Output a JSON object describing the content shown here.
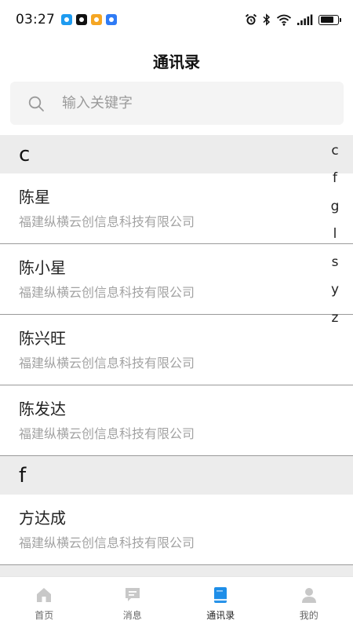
{
  "status_bar": {
    "time": "03:27",
    "app_icons": [
      {
        "name": "message-app-icon",
        "color": "#1e9bf0"
      },
      {
        "name": "tiktok-app-icon",
        "color": "#111111"
      },
      {
        "name": "chat-app-icon",
        "color": "#f5a623"
      },
      {
        "name": "browser-app-icon",
        "color": "#2f7bf5"
      }
    ],
    "battery_level": 0.8
  },
  "header": {
    "title": "通讯录"
  },
  "search": {
    "placeholder": "输入关键字"
  },
  "sections": [
    {
      "letter": "c",
      "contacts": [
        {
          "name": "陈星",
          "company": "福建纵横云创信息科技有限公司"
        },
        {
          "name": "陈小星",
          "company": "福建纵横云创信息科技有限公司"
        },
        {
          "name": "陈兴旺",
          "company": "福建纵横云创信息科技有限公司"
        },
        {
          "name": "陈发达",
          "company": "福建纵横云创信息科技有限公司"
        }
      ]
    },
    {
      "letter": "f",
      "contacts": [
        {
          "name": "方达成",
          "company": "福建纵横云创信息科技有限公司"
        }
      ]
    }
  ],
  "alpha_index": [
    "c",
    "f",
    "g",
    "l",
    "s",
    "y",
    "z"
  ],
  "tabs": [
    {
      "label": "首页",
      "icon": "home-icon",
      "active": false
    },
    {
      "label": "消息",
      "icon": "message-icon",
      "active": false
    },
    {
      "label": "通讯录",
      "icon": "contacts-book-icon",
      "active": true
    },
    {
      "label": "我的",
      "icon": "profile-icon",
      "active": false
    }
  ],
  "colors": {
    "active_tab": "#1e8ee8",
    "inactive_tab_icon": "#c8c8c8",
    "section_bg": "#ececec",
    "company_text": "#a3a3a3"
  }
}
